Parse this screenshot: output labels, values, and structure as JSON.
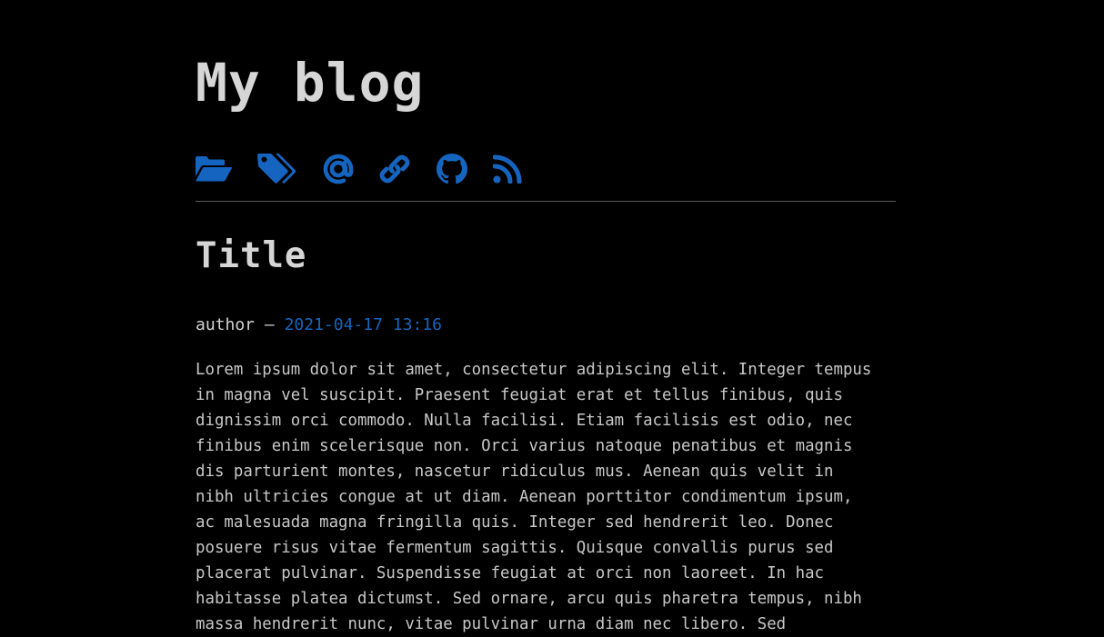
{
  "site": {
    "title": "My blog"
  },
  "nav": {
    "accent_color": "#1565c0",
    "items": [
      {
        "icon": "folder-open-icon"
      },
      {
        "icon": "tags-icon"
      },
      {
        "icon": "at-icon"
      },
      {
        "icon": "link-icon"
      },
      {
        "icon": "github-icon"
      },
      {
        "icon": "rss-icon"
      }
    ]
  },
  "post": {
    "title": "Title",
    "author": "author",
    "separator": "—",
    "date": "2021-04-17 13:16",
    "body_lines": [
      "Lorem ipsum dolor sit amet, consectetur adipiscing elit. Integer tempus",
      "in magna vel suscipit. Praesent feugiat erat et tellus finibus, quis",
      "dignissim orci commodo. Nulla facilisi. Etiam facilisis est odio, nec",
      "finibus enim scelerisque non. Orci varius natoque penatibus et magnis",
      "dis parturient montes, nascetur ridiculus mus. Aenean quis velit in",
      "nibh ultricies congue at ut diam. Aenean porttitor condimentum ipsum,",
      "ac malesuada magna fringilla quis. Integer sed hendrerit leo. Donec",
      "posuere risus vitae fermentum sagittis. Quisque convallis purus sed",
      "placerat pulvinar. Suspendisse feugiat at orci non laoreet. In hac",
      "habitasse platea dictumst. Sed ornare, arcu quis pharetra tempus, nibh",
      "massa hendrerit nunc, vitae pulvinar urna diam nec libero. Sed"
    ]
  }
}
